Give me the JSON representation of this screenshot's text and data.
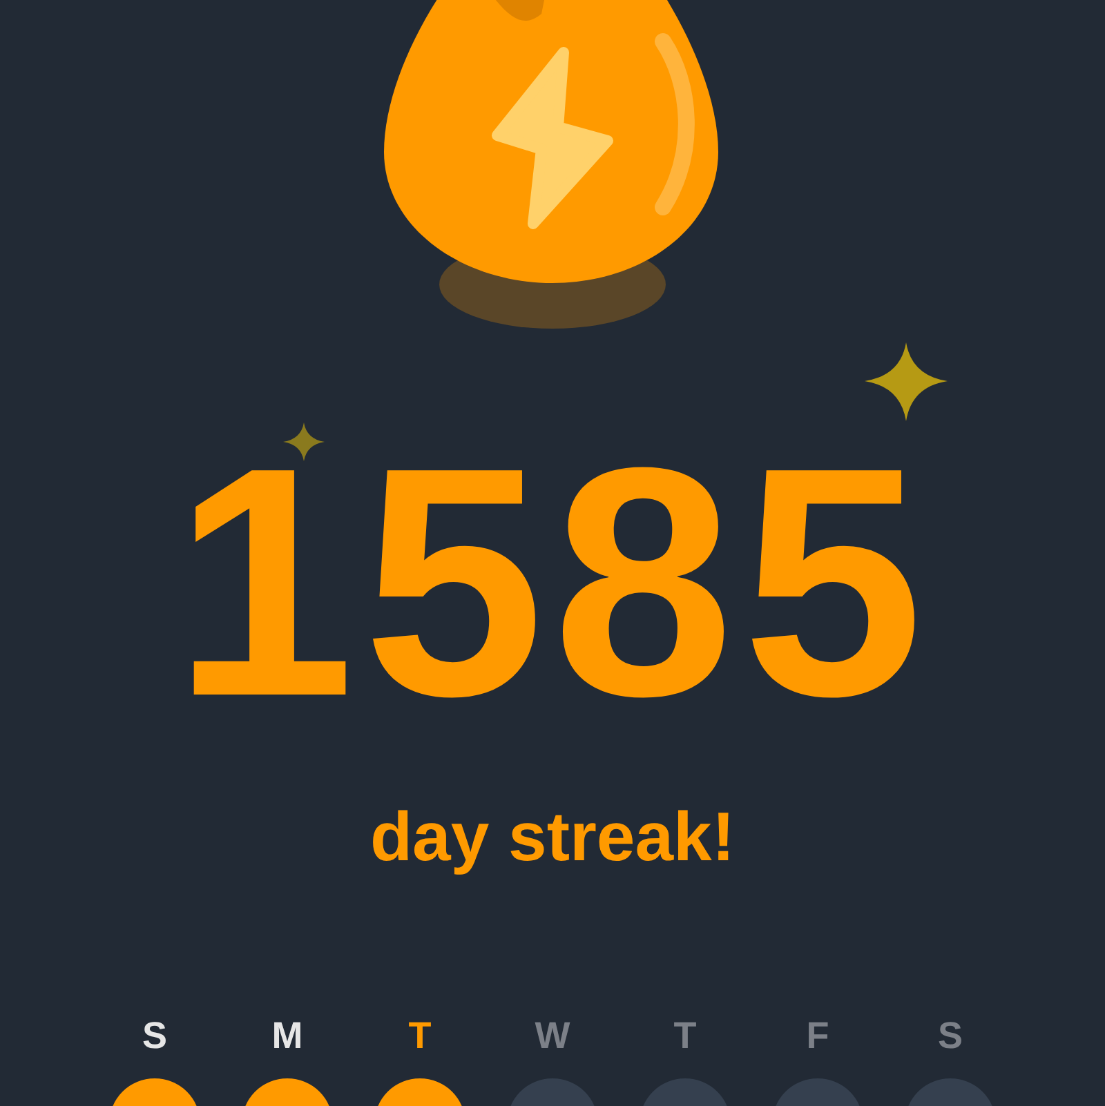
{
  "streak": {
    "count": "1585",
    "label": "day streak!"
  },
  "week": [
    {
      "letter": "S",
      "done": true,
      "today": false
    },
    {
      "letter": "M",
      "done": true,
      "today": false
    },
    {
      "letter": "T",
      "done": true,
      "today": true
    },
    {
      "letter": "W",
      "done": false,
      "today": false
    },
    {
      "letter": "T",
      "done": false,
      "today": false
    },
    {
      "letter": "F",
      "done": false,
      "today": false
    },
    {
      "letter": "S",
      "done": false,
      "today": false
    }
  ]
}
